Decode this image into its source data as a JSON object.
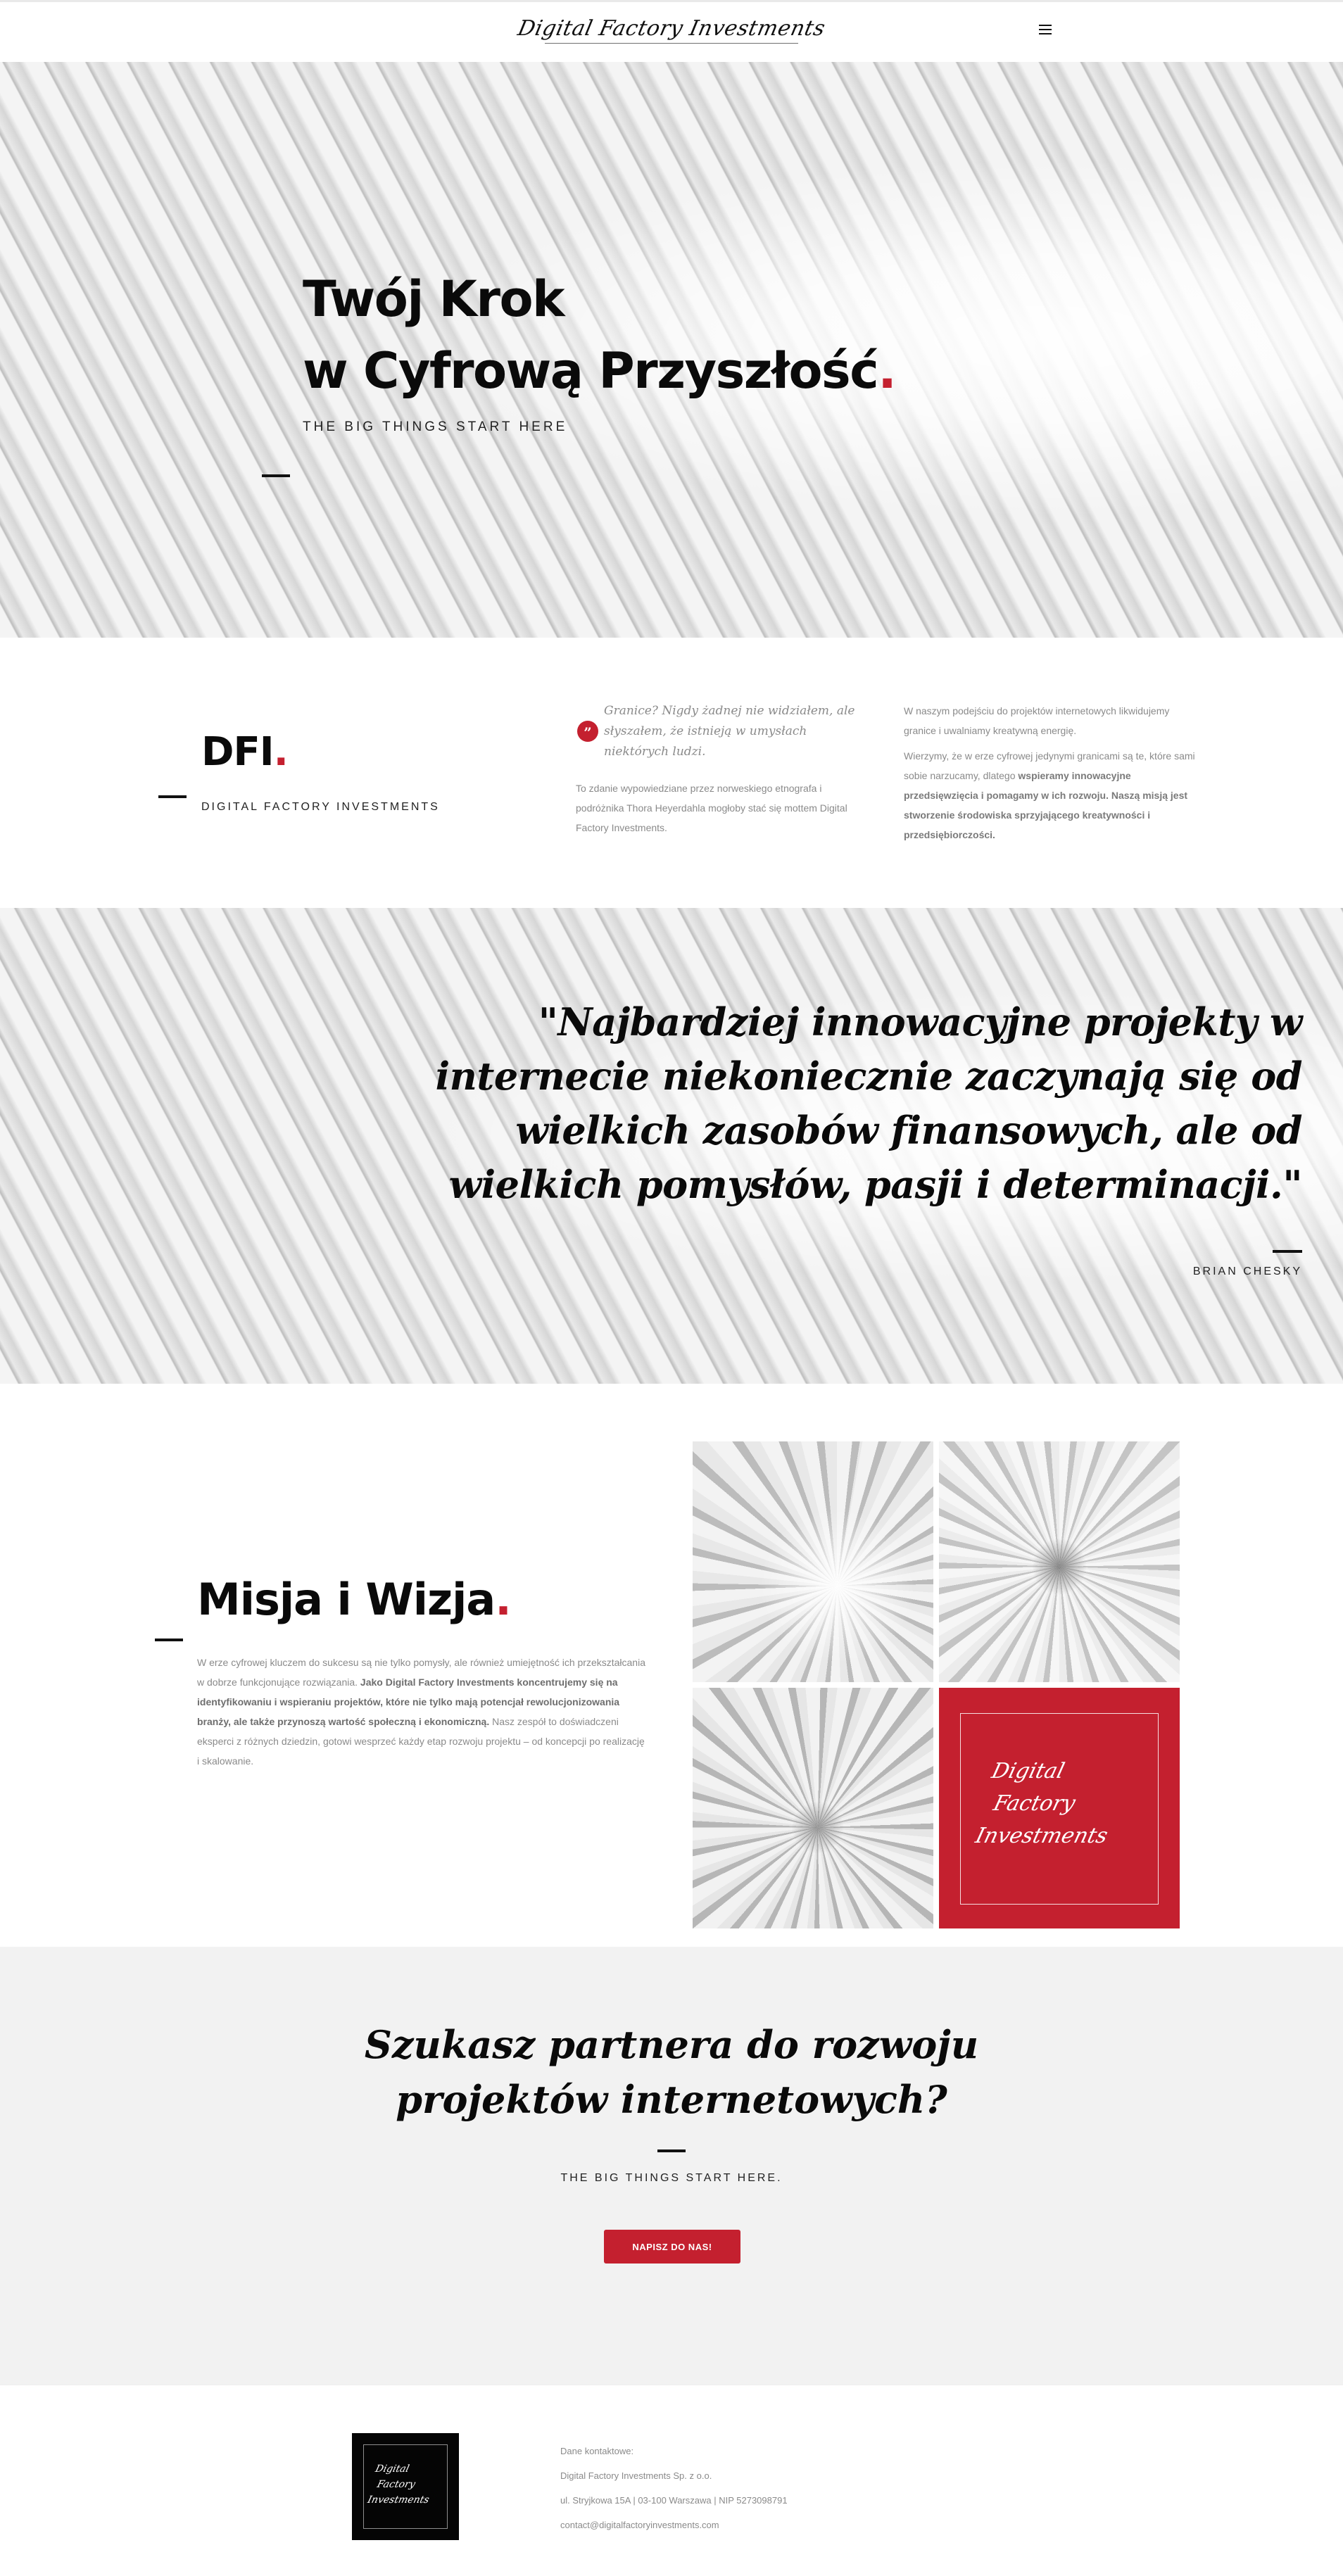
{
  "header": {
    "logo_text": "Digital Factory Investments",
    "menu_icon": "hamburger-icon"
  },
  "hero": {
    "title_line1": "Twój Krok",
    "title_line2": "w Cyfrową Przyszłość",
    "title_dot": ".",
    "tagline": "THE BIG THINGS START HERE"
  },
  "about": {
    "heading": "DFI",
    "heading_dot": ".",
    "subheading": "DIGITAL FACTORY INVESTMENTS",
    "quote": "Granice? Nigdy żadnej nie widziałem, ale słyszałem, że istnieją w umysłach niektórych ludzi.",
    "quote_icon": "quote-icon",
    "col1_text": "To zdanie wypowiedziane przez norweskiego etnografa i podróżnika Thora Heyerdahla mogłoby stać się mottem Digital Factory Investments.",
    "col2_p1": "W naszym podejściu do projektów internetowych likwidujemy granice i uwalniamy kreatywną energię.",
    "col2_p2_plain": "Wierzymy, że w erze cyfrowej jedynymi granicami są te, które sami sobie narzucamy, dlatego",
    "col2_p2_bold": "wspieramy innowacyjne przedsięwzięcia i pomagamy w ich rozwoju. Naszą misją jest stworzenie środowiska sprzyjającego kreatywności i przedsiębiorczości."
  },
  "quote_band": {
    "quote": "\"Najbardziej innowacyjne projekty w internecie niekoniecznie zaczynają się od wielkich zasobów finansowych, ale od wielkich pomysłów, pasji i determinacji.\"",
    "author": "BRIAN CHESKY"
  },
  "mission": {
    "heading": "Misja i Wizja",
    "heading_dot": ".",
    "text_plain1": "W erze cyfrowej kluczem do sukcesu są nie tylko pomysły, ale również umiejętność ich przekształcania w dobrze funkcjonujące rozwiązania.",
    "text_bold": "Jako Digital Factory Investments koncentrujemy się na identyfikowaniu i wspieraniu projektów, które nie tylko mają potencjał rewolucjonizowania branży, ale także przynoszą wartość społeczną i ekonomiczną.",
    "text_plain2": "Nasz zespół to doświadczeni eksperci z różnych dziedzin, gotowi wesprzeć każdy etap rozwoju projektu – od koncepcji po realizację i skalowanie.",
    "tile_brand_line1": "Digital",
    "tile_brand_line2": "Factory",
    "tile_brand_line3": "Investments"
  },
  "cta": {
    "heading_line1": "Szukasz partnera do rozwoju",
    "heading_line2": "projektów internetowych?",
    "subheading": "THE BIG THINGS START HERE.",
    "button_label": "NAPISZ DO NAS!"
  },
  "footer": {
    "logo_line1": "Digital",
    "logo_line2": "Factory",
    "logo_line3": "Investments",
    "contact_label": "Dane kontaktowe:",
    "company": "Digital Factory Investments Sp. z o.o.",
    "address": "ul. Stryjkowa 15A | 03-100 Warszawa | NIP 5273098791",
    "email": "contact@digitalfactoryinvestments.com"
  },
  "colors": {
    "accent": "#c4202f",
    "text": "#0a0a0a",
    "muted": "#8a8a8a",
    "cta_bg": "#f2f2f2"
  }
}
